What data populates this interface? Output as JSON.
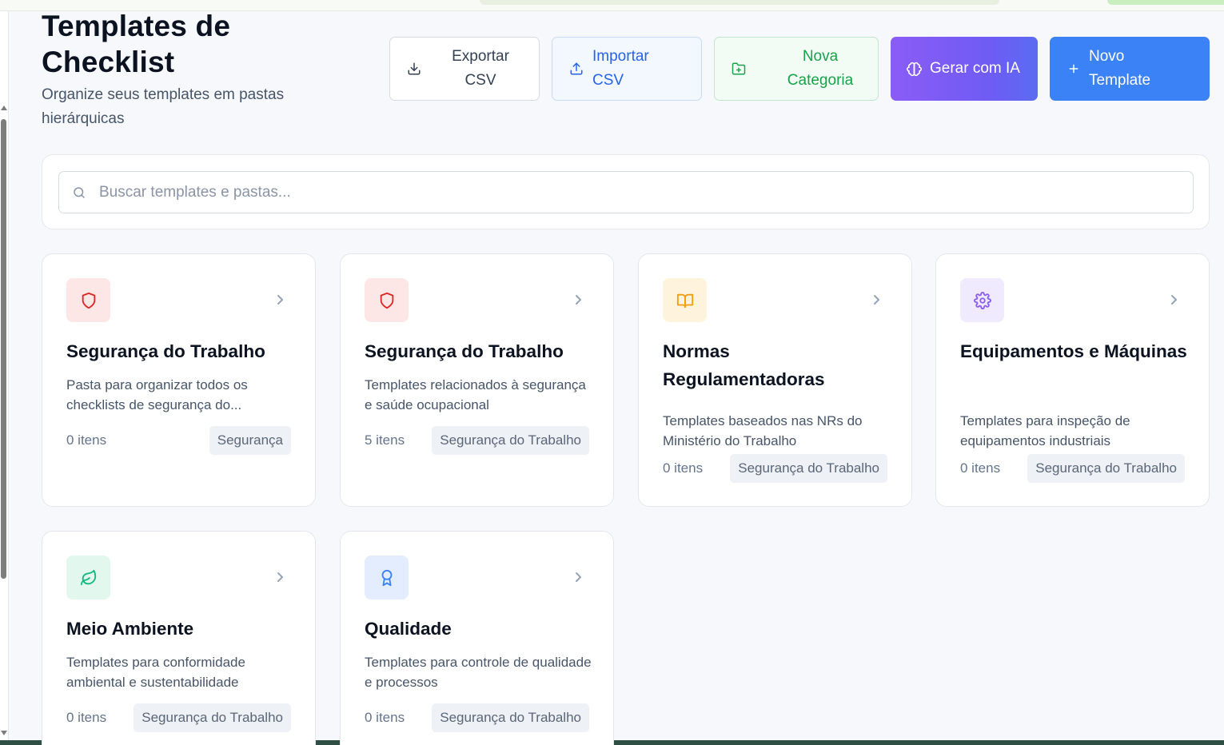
{
  "colors": {
    "red": "#dc2626",
    "red_bg": "#fde6e6",
    "amber": "#f59e0b",
    "amber_bg": "#fef3dc",
    "purple": "#8b5cf6",
    "purple_bg": "#efeafe",
    "green": "#10b981",
    "green_bg": "#e2f7ee",
    "blue": "#3b82f6",
    "blue_bg": "#e3edfd"
  },
  "header": {
    "title": "Templates de Checklist",
    "subtitle": "Organize seus templates em pastas hierárquicas"
  },
  "toolbar": {
    "export_label": "Exportar CSV",
    "import_label": "Importar CSV",
    "new_category_label": "Nova Categoria",
    "ai_label": "Gerar com IA",
    "new_template_label": "Novo Template"
  },
  "search": {
    "placeholder": "Buscar templates e pastas...",
    "value": ""
  },
  "cards": [
    {
      "title": "Segurança do Trabalho",
      "description": "Pasta para organizar todos os checklists de segurança do...",
      "count": "0 itens",
      "tag": "Segurança",
      "icon": "shield-icon",
      "color": "red"
    },
    {
      "title": "Segurança do Trabalho",
      "description": "Templates relacionados à segurança e saúde ocupacional",
      "count": "5 itens",
      "tag": "Segurança do Trabalho",
      "icon": "shield-icon",
      "color": "red"
    },
    {
      "title": "Normas Regulamentadoras",
      "description": "Templates baseados nas NRs do Ministério do Trabalho",
      "count": "0 itens",
      "tag": "Segurança do Trabalho",
      "icon": "book-open-icon",
      "color": "amber"
    },
    {
      "title": "Equipamentos e Máquinas",
      "description": "Templates para inspeção de equipamentos industriais",
      "count": "0 itens",
      "tag": "Segurança do Trabalho",
      "icon": "gear-icon",
      "color": "purple"
    },
    {
      "title": "Meio Ambiente",
      "description": "Templates para conformidade ambiental e sustentabilidade",
      "count": "0 itens",
      "tag": "Segurança do Trabalho",
      "icon": "leaf-icon",
      "color": "green"
    },
    {
      "title": "Qualidade",
      "description": "Templates para controle de qualidade e processos",
      "count": "0 itens",
      "tag": "Segurança do Trabalho",
      "icon": "award-icon",
      "color": "blue"
    }
  ]
}
